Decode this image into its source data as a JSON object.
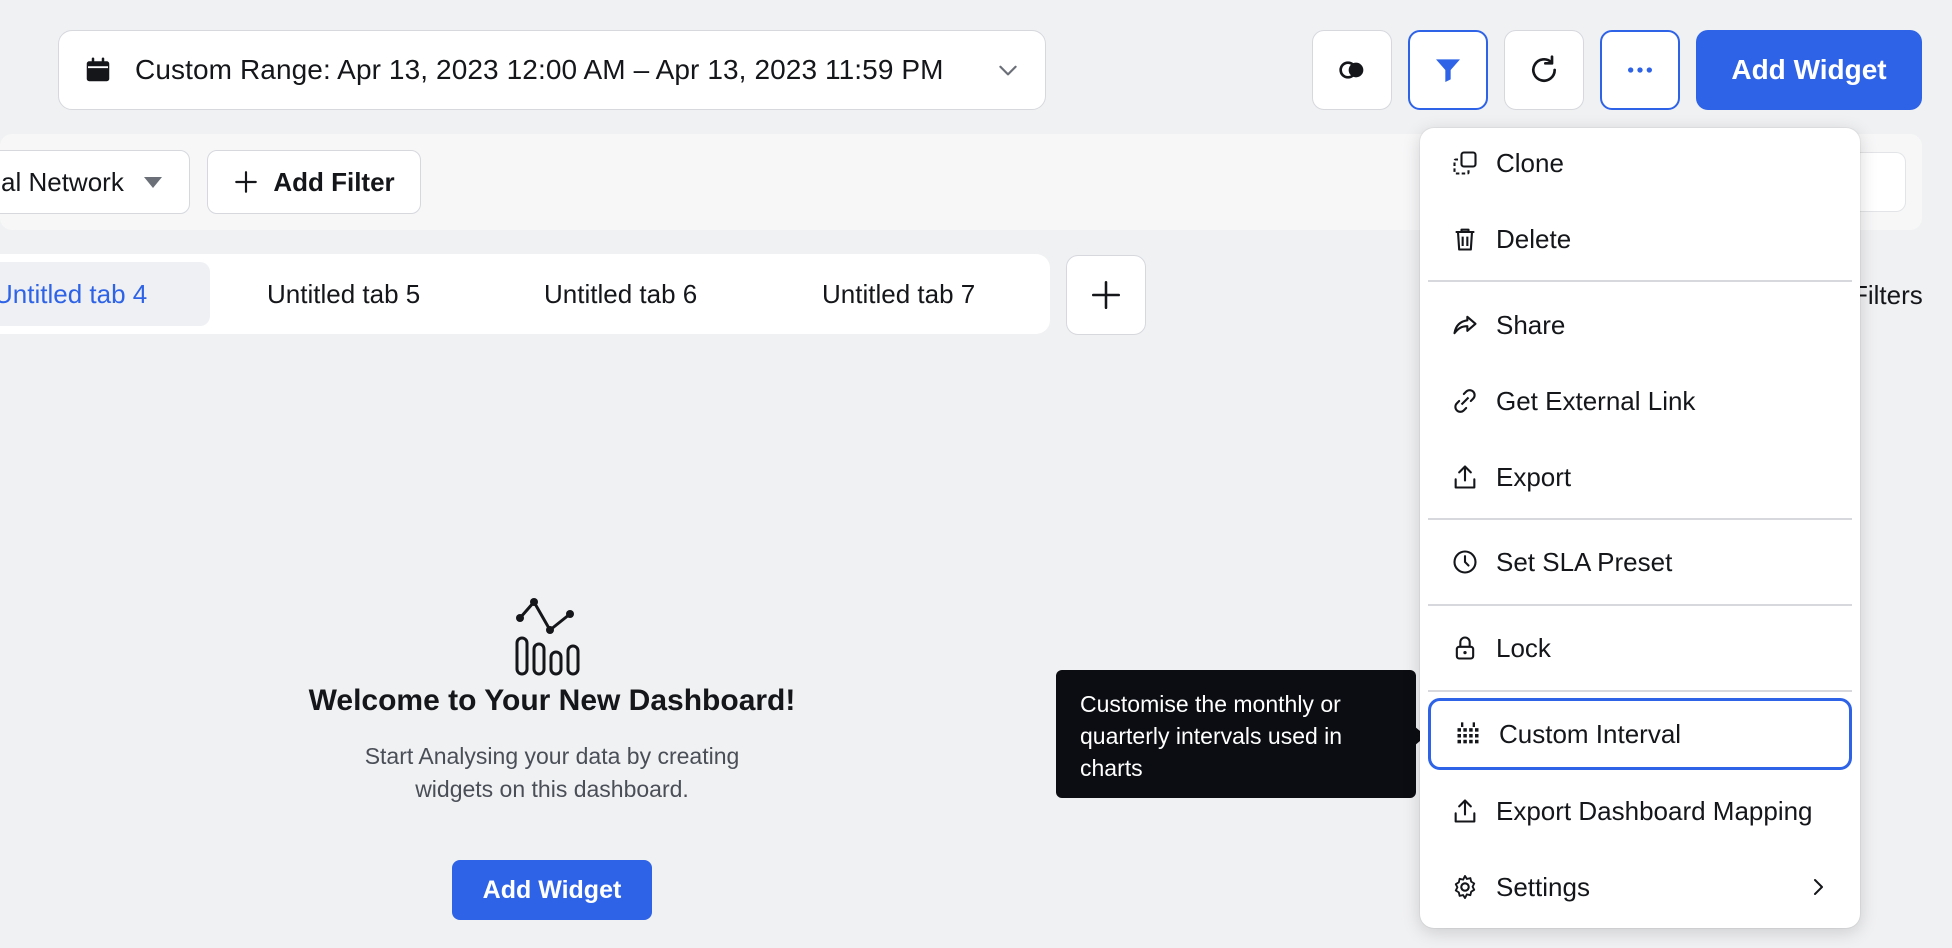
{
  "header": {
    "date_range": "Custom Range: Apr 13, 2023 12:00 AM – Apr 13, 2023 11:59 PM",
    "add_widget_label": "Add Widget"
  },
  "filters": {
    "network_chip": "al Network",
    "add_filter_label": "Add Filter",
    "filters_link": "Filters"
  },
  "tabs": [
    {
      "label": "Untitled tab 4",
      "active": true
    },
    {
      "label": "Untitled tab 5"
    },
    {
      "label": "Untitled tab 6"
    },
    {
      "label": "Untitled tab 7"
    }
  ],
  "empty_state": {
    "title": "Welcome to Your New Dashboard!",
    "subtitle_line1": "Start Analysing your data by creating",
    "subtitle_line2": "widgets on this dashboard.",
    "button_label": "Add Widget"
  },
  "tooltip": {
    "line1": "Customise the monthly or",
    "line2": "quarterly intervals used in",
    "line3": "charts"
  },
  "menu": {
    "items": [
      {
        "label": "Clone",
        "icon": "clone-icon"
      },
      {
        "label": "Delete",
        "icon": "trash-icon"
      },
      {
        "label": "Share",
        "icon": "share-icon"
      },
      {
        "label": "Get External Link",
        "icon": "link-icon"
      },
      {
        "label": "Export",
        "icon": "export-icon"
      },
      {
        "label": "Set SLA Preset",
        "icon": "clock-icon"
      },
      {
        "label": "Lock",
        "icon": "lock-icon"
      },
      {
        "label": "Custom Interval",
        "icon": "calendar-grid-icon",
        "selected": true
      },
      {
        "label": "Export Dashboard Mapping",
        "icon": "export-icon"
      },
      {
        "label": "Settings",
        "icon": "gear-icon",
        "has_submenu": true
      }
    ]
  },
  "colors": {
    "accent": "#2e63e7",
    "background": "#f0f1f3",
    "tooltip_bg": "#0b0d12"
  }
}
